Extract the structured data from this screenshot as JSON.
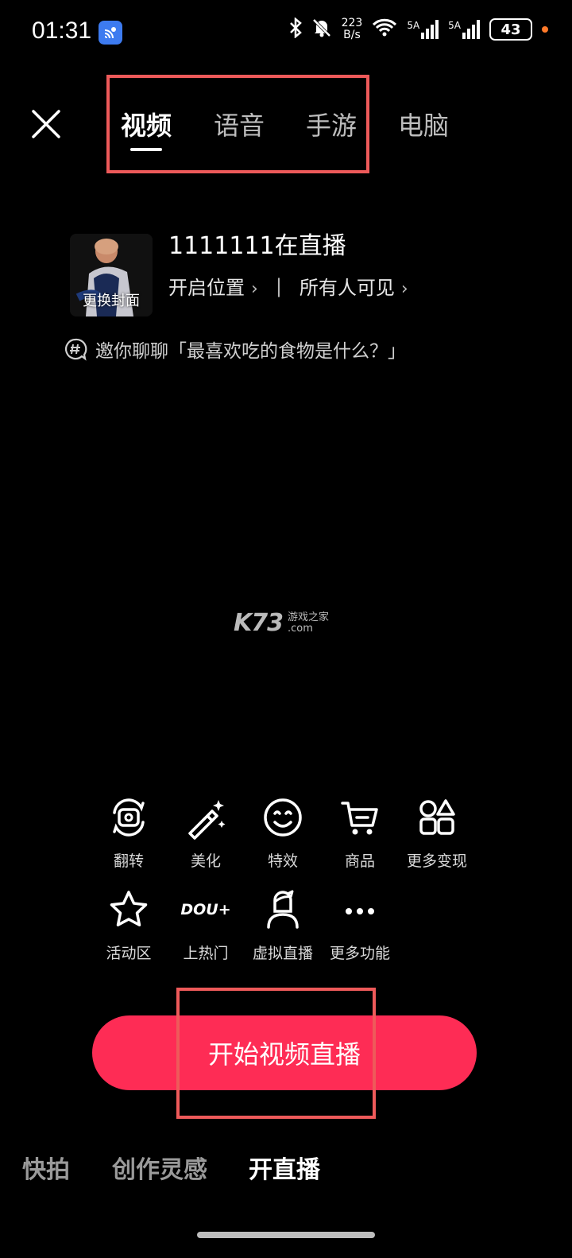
{
  "status_bar": {
    "time": "01:31",
    "net_speed_value": "223",
    "net_speed_unit": "B/s",
    "sim1_label": "5A",
    "sim2_label": "5A",
    "battery": "43",
    "icons": [
      "cast-icon",
      "bluetooth-icon",
      "mute-bell-icon",
      "wifi-icon",
      "signal-icon",
      "battery-icon"
    ]
  },
  "top_tabs": {
    "items": [
      {
        "label": "视频",
        "active": true
      },
      {
        "label": "语音",
        "active": false
      },
      {
        "label": "手游",
        "active": false
      },
      {
        "label": "电脑",
        "active": false
      }
    ]
  },
  "live_info": {
    "cover_label": "更换封面",
    "title": "1111111在直播",
    "location_label": "开启位置",
    "visibility_label": "所有人可见",
    "topic_text": "邀你聊聊「最喜欢吃的食物是什么？」"
  },
  "watermark": {
    "logo": "K73",
    "name": "游戏之家",
    "domain": ".com"
  },
  "tools": [
    {
      "label": "翻转",
      "icon": "flip-camera-icon"
    },
    {
      "label": "美化",
      "icon": "magic-wand-icon"
    },
    {
      "label": "特效",
      "icon": "smiley-effects-icon"
    },
    {
      "label": "商品",
      "icon": "shopping-cart-icon"
    },
    {
      "label": "更多变现",
      "icon": "more-monetize-icon"
    },
    {
      "label": "活动区",
      "icon": "star-icon"
    },
    {
      "label": "上热门",
      "icon": "dou-plus-icon"
    },
    {
      "label": "虚拟直播",
      "icon": "virtual-avatar-icon"
    },
    {
      "label": "更多功能",
      "icon": "more-dots-icon"
    }
  ],
  "dou_plus_text": "DOU+",
  "start_button": {
    "label": "开始视频直播",
    "color": "#fe2c55"
  },
  "bottom_modes": [
    {
      "label": "快拍",
      "active": false
    },
    {
      "label": "创作灵感",
      "active": false
    },
    {
      "label": "开直播",
      "active": true
    }
  ],
  "colors": {
    "accent": "#fe2c55",
    "highlight_box": "#ee5a5a",
    "cast_badge": "#3d7bf0",
    "battery_dot": "#ff7a2a"
  }
}
